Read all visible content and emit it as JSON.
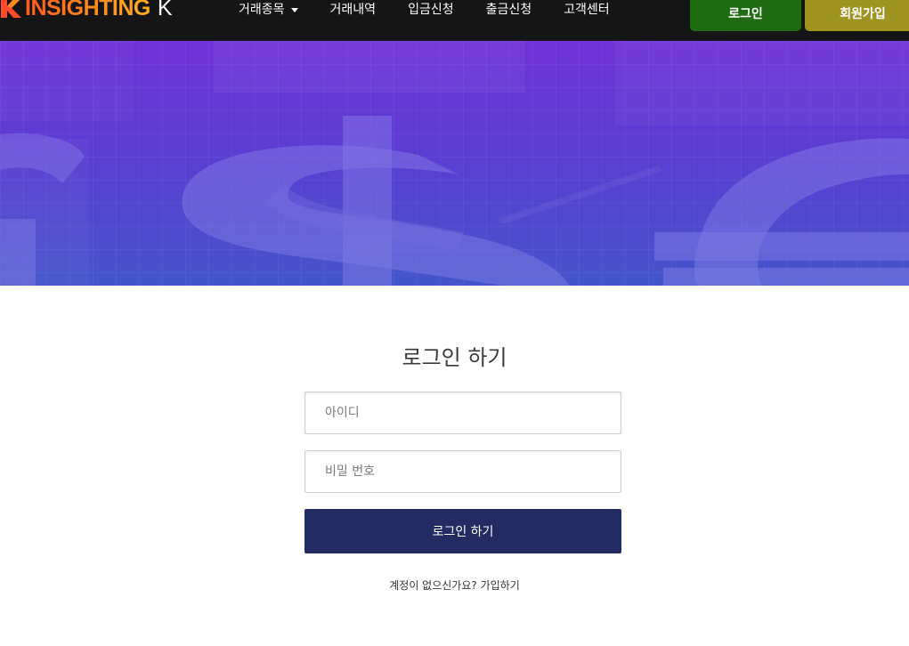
{
  "header": {
    "logo": {
      "text": "INSIGHTING",
      "suffix": "K"
    },
    "nav": [
      {
        "label": "거래종목",
        "has_dropdown": true
      },
      {
        "label": "거래내역"
      },
      {
        "label": "입금신청"
      },
      {
        "label": "출금신청"
      },
      {
        "label": "고객센터"
      }
    ],
    "login_button": "로그인",
    "join_button": "회원가입"
  },
  "hero": {
    "image": "currency-symbols-banner",
    "colors": [
      "#6a2fd6",
      "#4a52c9"
    ]
  },
  "login_form": {
    "title": "로그인 하기",
    "id_placeholder": "아이디",
    "password_placeholder": "비밀 번호",
    "submit_label": "로그인 하기",
    "signup_prompt": "계정이 없으신가요?",
    "signup_link": "가입하기"
  },
  "colors": {
    "navbar_bg": "#151515",
    "login_button_bg": "#1f6b12",
    "join_button_bg": "#a09420",
    "submit_bg": "#222c63"
  }
}
